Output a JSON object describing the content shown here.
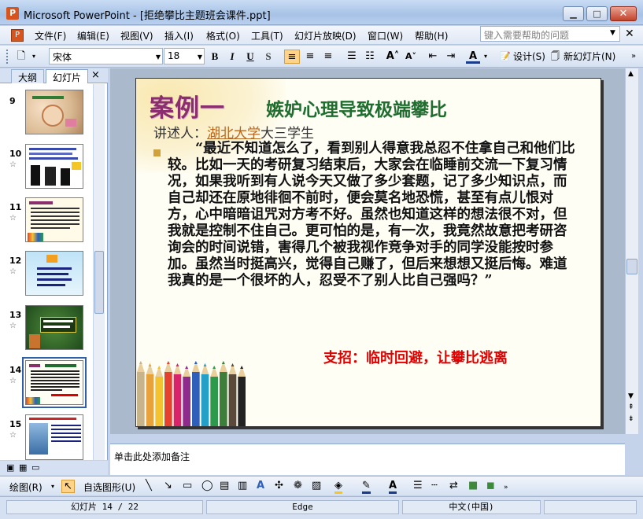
{
  "window": {
    "title": "Microsoft PowerPoint - [拒绝攀比主题班会课件.ppt]",
    "app_icon_glyph": "P"
  },
  "menu": {
    "items": [
      "文件(F)",
      "编辑(E)",
      "视图(V)",
      "插入(I)",
      "格式(O)",
      "工具(T)",
      "幻灯片放映(D)",
      "窗口(W)",
      "帮助(H)"
    ],
    "help_placeholder": "键入需要帮助的问题"
  },
  "toolbar": {
    "font": "宋体",
    "size": "18",
    "bold": "B",
    "italic": "I",
    "underline": "U",
    "shadow": "S",
    "design_label": "设计(S)",
    "new_slide_label": "新幻灯片(N)"
  },
  "panel": {
    "tab_outline": "大纲",
    "tab_slides": "幻灯片",
    "close": "×",
    "slides": [
      {
        "num": "9",
        "star": ""
      },
      {
        "num": "10",
        "star": "☆"
      },
      {
        "num": "11",
        "star": "☆"
      },
      {
        "num": "12",
        "star": "☆"
      },
      {
        "num": "13",
        "star": "☆"
      },
      {
        "num": "14",
        "star": "☆"
      },
      {
        "num": "15",
        "star": "☆"
      }
    ]
  },
  "slide": {
    "case_title": "案例一",
    "main_title": "嫉妒心理导致极端攀比",
    "presenter_prefix": "讲述人：",
    "presenter_link": "湖北大学",
    "presenter_suffix": "大三学生",
    "body": "“最近不知道怎么了，看到别人得意我总忍不住拿自己和他们比较。比如一天的考研复习结束后，大家会在临睡前交流一下复习情况，如果我听到有人说今天又做了多少套题，记了多少知识点，而自己却还在原地徘徊不前时，便会莫名地恐慌，甚至有点儿恨对方，心中暗暗诅咒对方考不好。虽然也知道这样的想法很不对，但我就是控制不住自己。更可怕的是，有一次，我竟然故意把考研咨询会的时间说错，害得几个被我视作竞争对手的同学没能按时参加。虽然当时挺高兴，觉得自己赚了，但后来想想又挺后悔。难道我真的是一个很坏的人，忍受不了别人比自己强吗？”",
    "strategy": "支招：临时回避，让攀比逃离",
    "pencil_colors": [
      "#c8b48a",
      "#e8a23a",
      "#f2c230",
      "#e4412e",
      "#d9236b",
      "#8e2b8c",
      "#2f5fb8",
      "#24a0c8",
      "#2c9a4a",
      "#3d7f3a",
      "#5b4a3a",
      "#222222"
    ]
  },
  "notes": {
    "placeholder": "单击此处添加备注"
  },
  "drawbar": {
    "draw_label": "绘图(R)",
    "autoshape_label": "自选图形(U)"
  },
  "status": {
    "slide_pos": "幻灯片 14 / 22",
    "template": "Edge",
    "language": "中文(中国)"
  }
}
